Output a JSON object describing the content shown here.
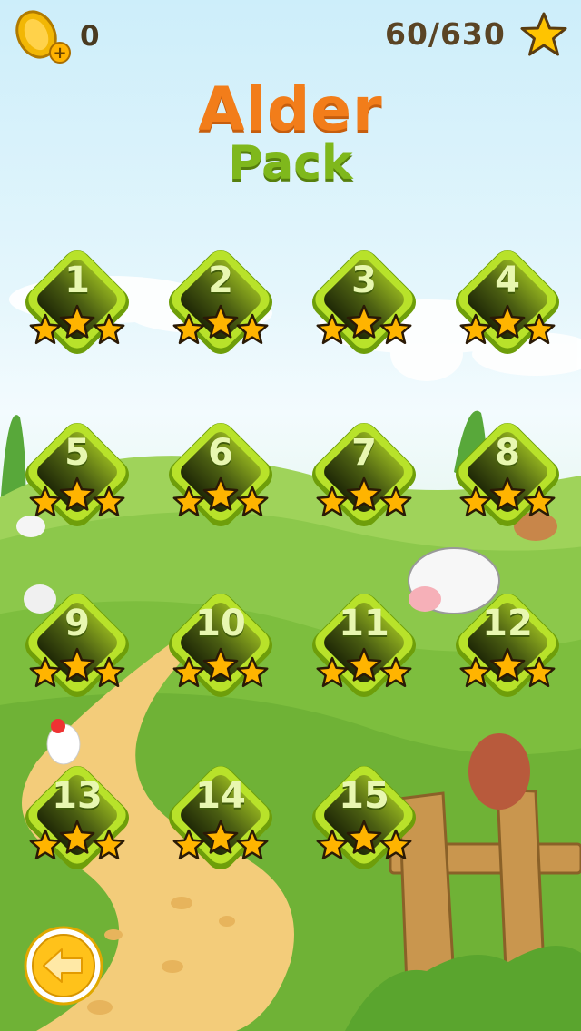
{
  "header": {
    "coins": "0",
    "stars_progress": "60/630"
  },
  "pack": {
    "title": "Alder",
    "subtitle": "Pack"
  },
  "levels": [
    {
      "number": "1",
      "stars": 3
    },
    {
      "number": "2",
      "stars": 3
    },
    {
      "number": "3",
      "stars": 3
    },
    {
      "number": "4",
      "stars": 3
    },
    {
      "number": "5",
      "stars": 3
    },
    {
      "number": "6",
      "stars": 3
    },
    {
      "number": "7",
      "stars": 3
    },
    {
      "number": "8",
      "stars": 3
    },
    {
      "number": "9",
      "stars": 3
    },
    {
      "number": "10",
      "stars": 3
    },
    {
      "number": "11",
      "stars": 3
    },
    {
      "number": "12",
      "stars": 3
    },
    {
      "number": "13",
      "stars": 3
    },
    {
      "number": "14",
      "stars": 3
    },
    {
      "number": "15",
      "stars": 3
    }
  ],
  "icons": {
    "coin": "coin-add-icon",
    "star": "star-icon",
    "back": "back-arrow-icon"
  },
  "colors": {
    "title": "#f27d1a",
    "subtitle": "#7fb81c",
    "badge_rim": "#9fd21e",
    "badge_inner": "#2e3a0c",
    "star": "#ffb400"
  }
}
